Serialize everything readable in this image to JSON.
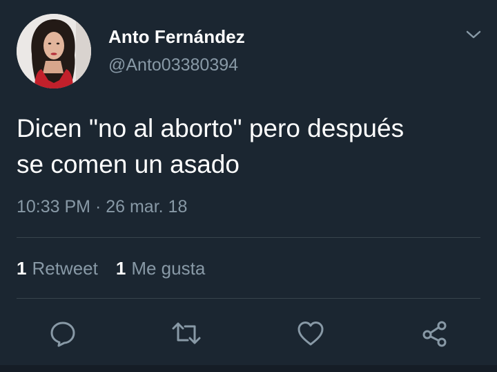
{
  "author": {
    "display_name": "Anto Fernández",
    "handle": "@Anto03380394"
  },
  "tweet": {
    "text": "Dicen \"no al aborto\" pero después\nse comen un asado",
    "timestamp": "10:33 PM · 26 mar. 18"
  },
  "stats": {
    "retweets_count": "1",
    "retweets_label": "Retweet",
    "likes_count": "1",
    "likes_label": "Me gusta"
  },
  "icons": {
    "caret": "chevron-down-icon",
    "reply": "reply-icon",
    "retweet": "retweet-icon",
    "like": "heart-icon",
    "share": "share-icon"
  },
  "colors": {
    "background": "#1b2631",
    "text_primary": "#ffffff",
    "text_secondary": "#8899a6",
    "divider": "#38444d"
  }
}
